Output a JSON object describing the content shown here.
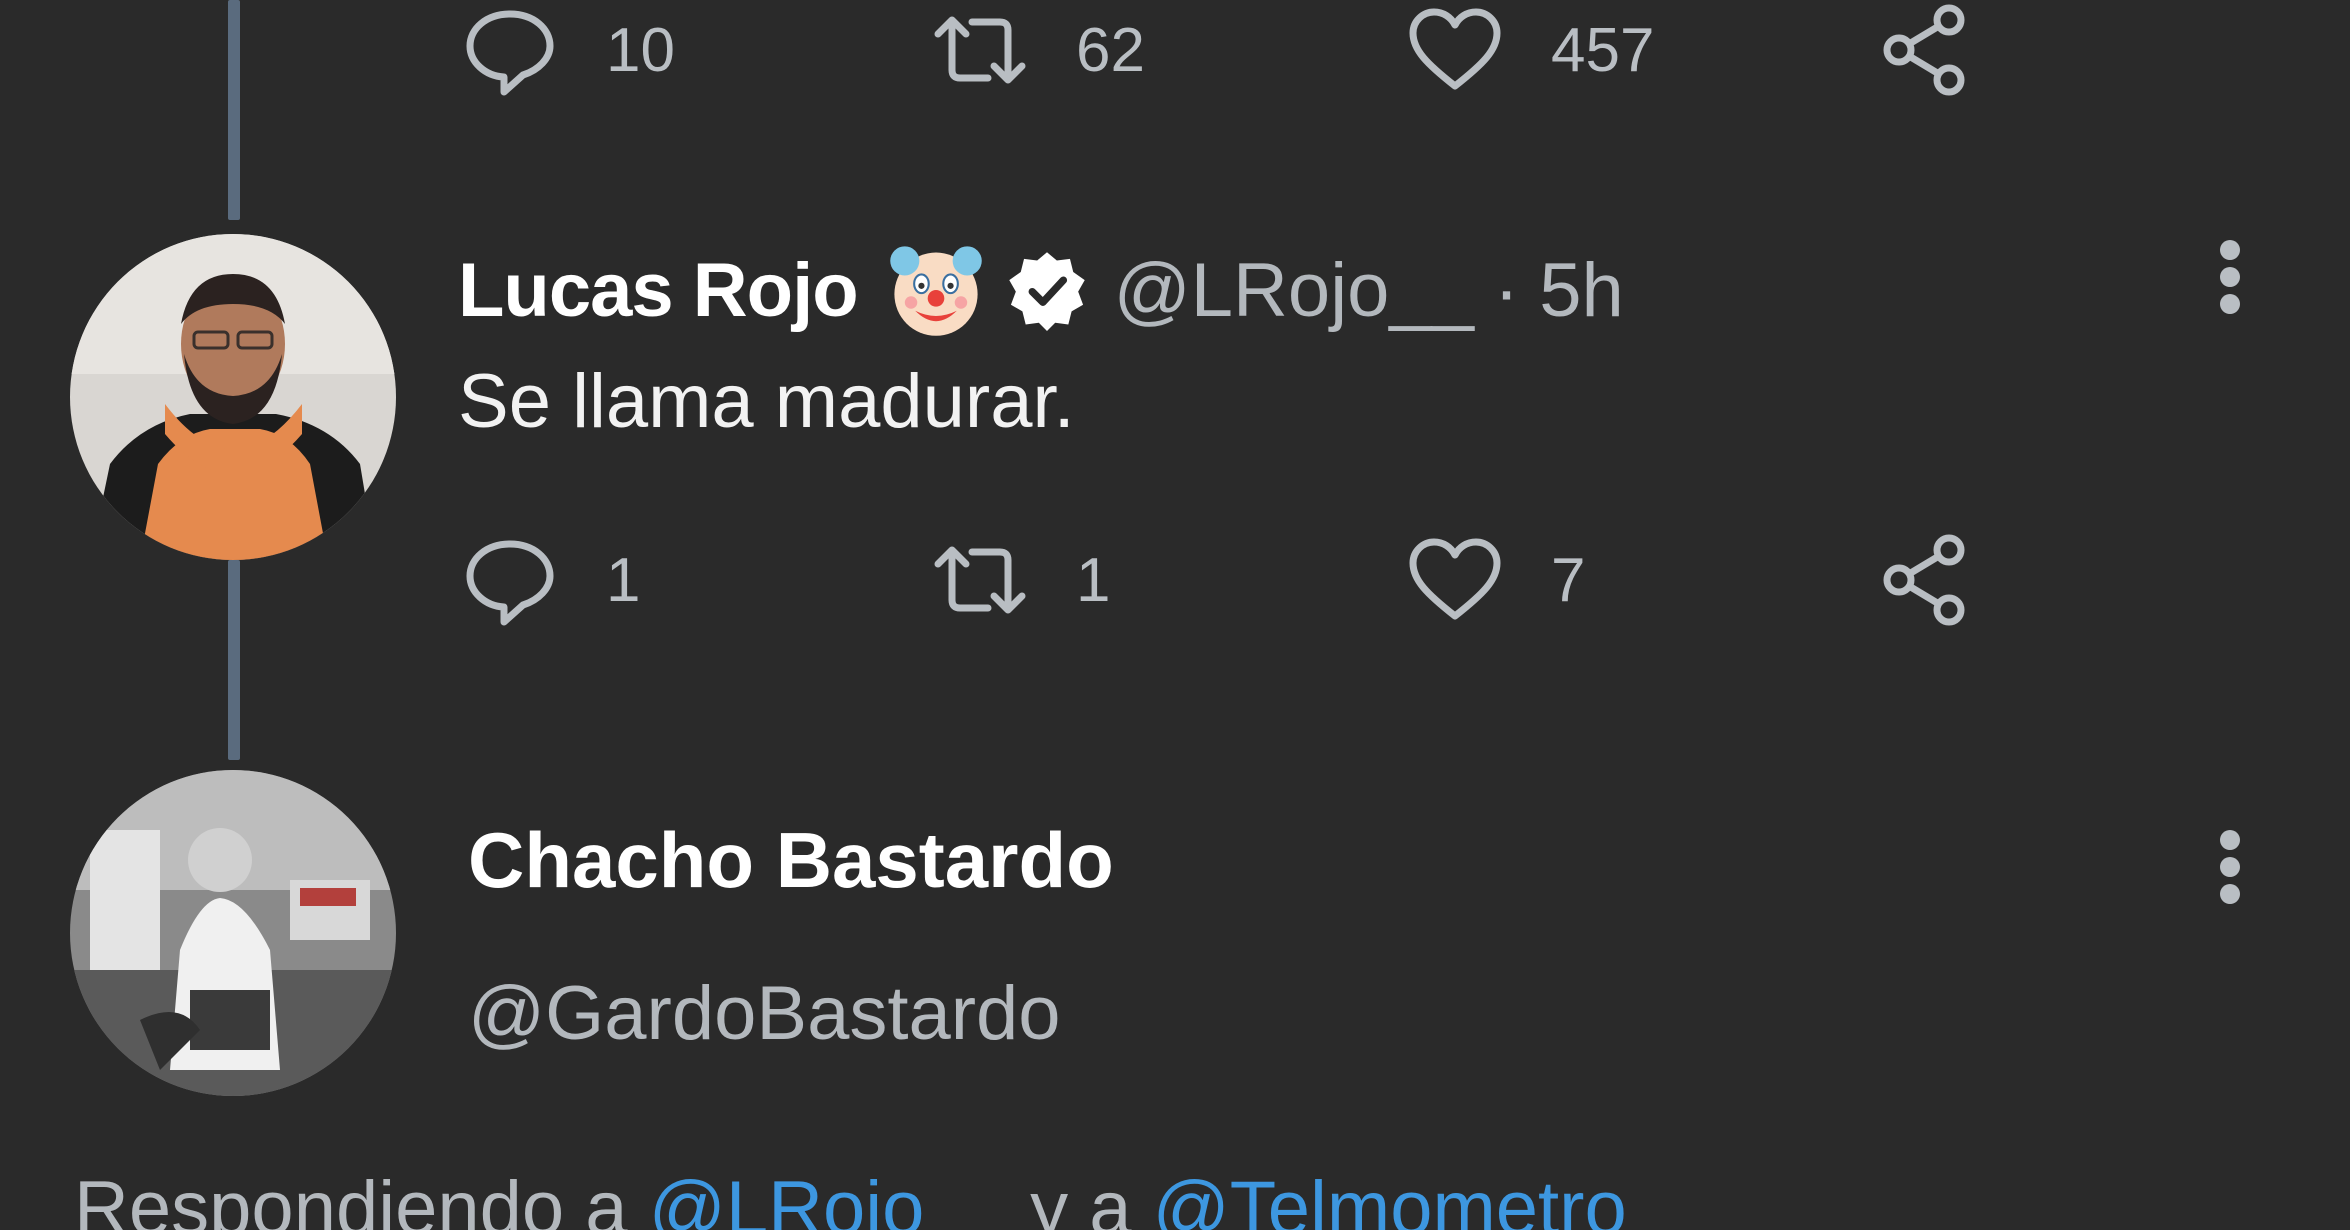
{
  "top_tweet": {
    "actions": {
      "reply_count": "10",
      "retweet_count": "62",
      "like_count": "457"
    }
  },
  "reply_tweet": {
    "display_name": "Lucas Rojo",
    "handle": "@LRojo__",
    "separator": "·",
    "time": "5h",
    "text": "Se llama madurar.",
    "actions": {
      "reply_count": "1",
      "retweet_count": "1",
      "like_count": "7"
    }
  },
  "third_tweet": {
    "display_name": "Chacho Bastardo",
    "handle": "@GardoBastardo",
    "replying": {
      "prefix": "Respondiendo a",
      "mention1": "@LRojo__",
      "joiner": "y a",
      "mention2": "@Telmometro"
    }
  },
  "colors": {
    "background": "#2a2a2a",
    "thread_line": "#5a6b7e",
    "mention": "#3d97e0",
    "muted_text": "#b3b8bd"
  },
  "icons": [
    "reply-icon",
    "retweet-icon",
    "like-icon",
    "share-icon",
    "more-options-icon",
    "clown-emoji-icon",
    "verified-badge-icon"
  ]
}
